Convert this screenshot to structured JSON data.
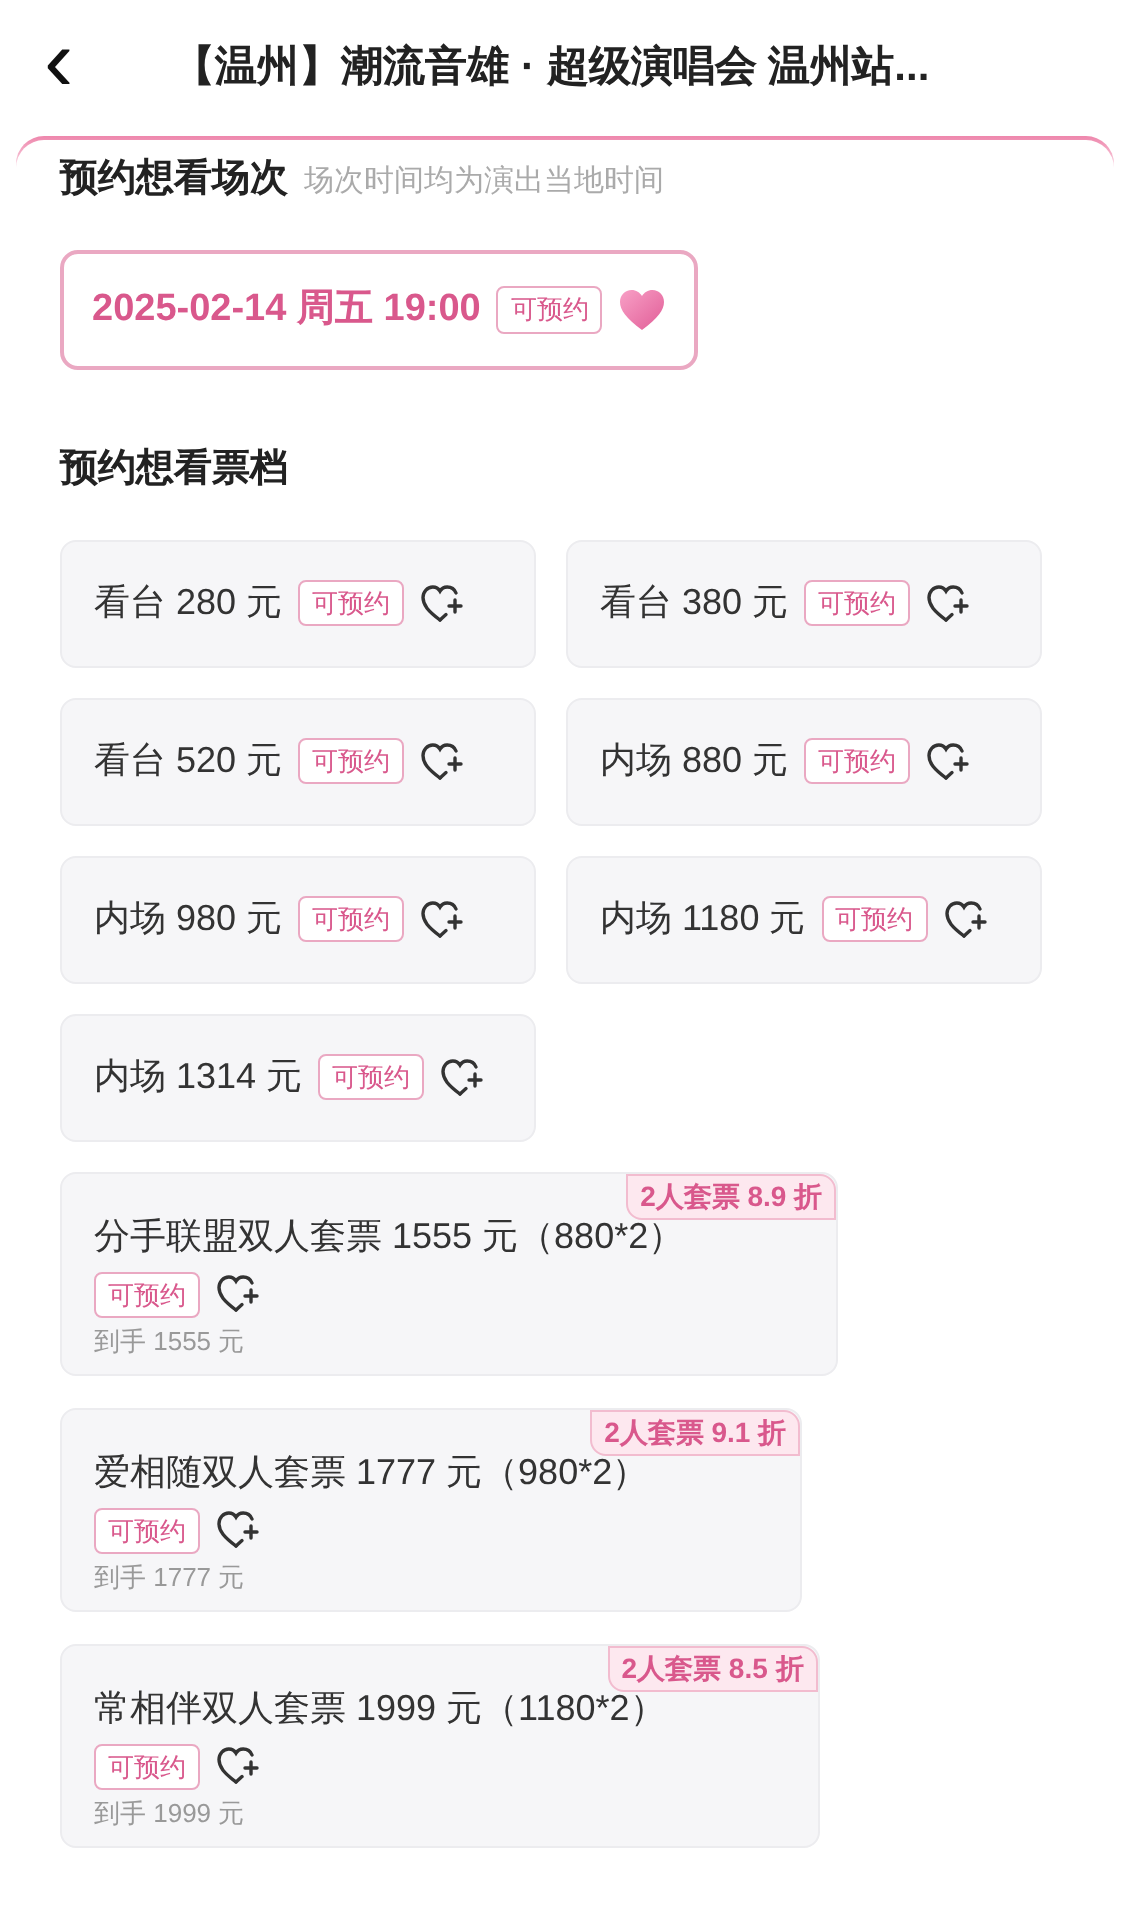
{
  "header": {
    "back": "‹",
    "title": "【温州】潮流音雄 · 超级演唱会 温州站..."
  },
  "session_section": {
    "heading": "预约想看场次",
    "note": "场次时间均为演出当地时间",
    "sessions": [
      {
        "label": "2025-02-14 周五 19:00",
        "tag": "可预约",
        "selected": true
      }
    ]
  },
  "tier_section": {
    "heading": "预约想看票档",
    "tiers": [
      {
        "label": "看台 280 元",
        "tag": "可预约",
        "selected": false
      },
      {
        "label": "看台 380 元",
        "tag": "可预约",
        "selected": false
      },
      {
        "label": "看台 520 元",
        "tag": "可预约",
        "selected": false
      },
      {
        "label": "内场 880 元",
        "tag": "可预约",
        "selected": false
      },
      {
        "label": "内场 980 元",
        "tag": "可预约",
        "selected": false
      },
      {
        "label": "内场 1180 元",
        "tag": "可预约",
        "selected": false
      },
      {
        "label": "内场 1314 元",
        "tag": "可预约",
        "selected": false
      }
    ],
    "packages": [
      {
        "label": "分手联盟双人套票 1555 元（880*2）",
        "tag": "可预约",
        "final_price": "到手 1555 元",
        "discount": "2人套票 8.9 折",
        "selected": false
      },
      {
        "label": "爱相随双人套票 1777 元（980*2）",
        "tag": "可预约",
        "final_price": "到手 1777 元",
        "discount": "2人套票 9.1 折",
        "selected": false
      },
      {
        "label": "常相伴双人套票 1999 元（1180*2）",
        "tag": "可预约",
        "final_price": "到手 1999 元",
        "discount": "2人套票 8.5 折",
        "selected": false
      }
    ]
  }
}
